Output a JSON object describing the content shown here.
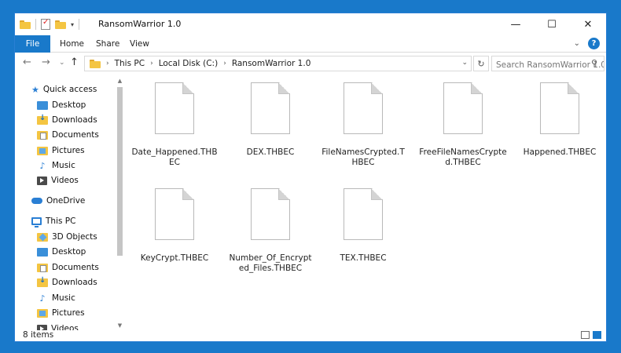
{
  "window": {
    "title": "RansomWarrior 1.0",
    "controls": {
      "minimize": "—",
      "maximize": "☐",
      "close": "✕"
    }
  },
  "ribbon": {
    "tabs": [
      "File",
      "Home",
      "Share",
      "View"
    ],
    "help": "?"
  },
  "address": {
    "path": [
      "This PC",
      "Local Disk (C:)",
      "RansomWarrior 1.0"
    ],
    "search_placeholder": "Search RansomWarrior 1.0"
  },
  "nav": {
    "quick_access": "Quick access",
    "quick_items": [
      "Desktop",
      "Downloads",
      "Documents",
      "Pictures",
      "Music",
      "Videos"
    ],
    "onedrive": "OneDrive",
    "this_pc": "This PC",
    "pc_items": [
      "3D Objects",
      "Desktop",
      "Documents",
      "Downloads",
      "Music",
      "Pictures",
      "Videos"
    ]
  },
  "files": [
    "Date_Happened.THBEC",
    "DEX.THBEC",
    "FileNamesCrypted.THBEC",
    "FreeFileNamesCrypted.THBEC",
    "Happened.THBEC",
    "KeyCrypt.THBEC",
    "Number_Of_Encrypted_Files.THBEC",
    "TEX.THBEC"
  ],
  "status": {
    "item_count": "8 items"
  },
  "colors": {
    "accent": "#1979ca",
    "folder": "#f4c542"
  }
}
